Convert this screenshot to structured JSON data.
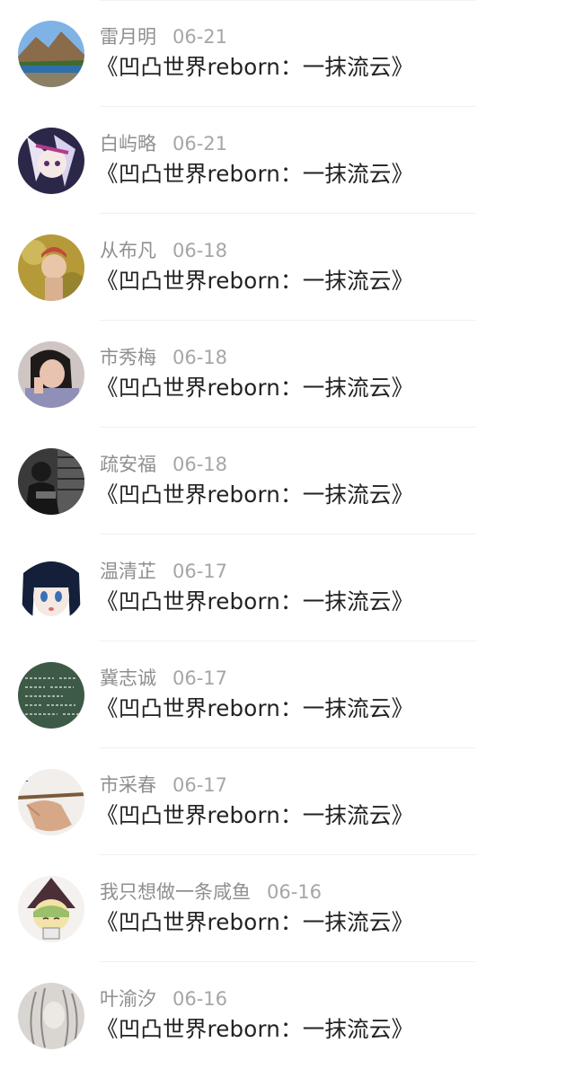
{
  "feed": {
    "items": [
      {
        "name": "雷月明",
        "date": "06-21",
        "title": "《凹凸世界reborn：一抹流云》",
        "avatar": "landscape-avatar"
      },
      {
        "name": "白屿略",
        "date": "06-21",
        "title": "《凹凸世界reborn：一抹流云》",
        "avatar": "anime-character-avatar"
      },
      {
        "name": "从布凡",
        "date": "06-18",
        "title": "《凹凸世界reborn：一抹流云》",
        "avatar": "girl-photo-avatar"
      },
      {
        "name": "市秀梅",
        "date": "06-18",
        "title": "《凹凸世界reborn：一抹流云》",
        "avatar": "laughing-girl-avatar"
      },
      {
        "name": "疏安福",
        "date": "06-18",
        "title": "《凹凸世界reborn：一抹流云》",
        "avatar": "monochrome-photo-avatar"
      },
      {
        "name": "温清芷",
        "date": "06-17",
        "title": "《凹凸世界reborn：一抹流云》",
        "avatar": "anime-girl-avatar"
      },
      {
        "name": "冀志诚",
        "date": "06-17",
        "title": "《凹凸世界reborn：一抹流云》",
        "avatar": "chalkboard-avatar"
      },
      {
        "name": "市采春",
        "date": "06-17",
        "title": "《凹凸世界reborn：一抹流云》",
        "avatar": "hand-pencil-avatar"
      },
      {
        "name": "我只想做一条咸鱼",
        "date": "06-16",
        "title": "《凹凸世界reborn：一抹流云》",
        "avatar": "chibi-avatar"
      },
      {
        "name": "叶渝汐",
        "date": "06-16",
        "title": "《凹凸世界reborn：一抹流云》",
        "avatar": "sketch-avatar"
      }
    ]
  }
}
